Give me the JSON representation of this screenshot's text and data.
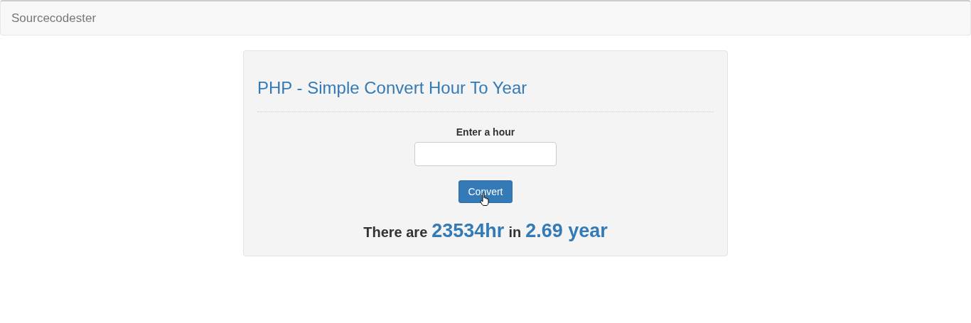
{
  "navbar": {
    "brand": "Sourcecodester"
  },
  "panel": {
    "title": "PHP - Simple Convert Hour To Year",
    "field": {
      "label": "Enter a hour"
    },
    "button": {
      "label": "Convert"
    },
    "result": [
      {
        "kind": "label",
        "text": "There are"
      },
      {
        "kind": "value",
        "text": "23534hr"
      },
      {
        "kind": "label",
        "text": "in"
      },
      {
        "kind": "value",
        "text": "2.69 year"
      }
    ]
  }
}
